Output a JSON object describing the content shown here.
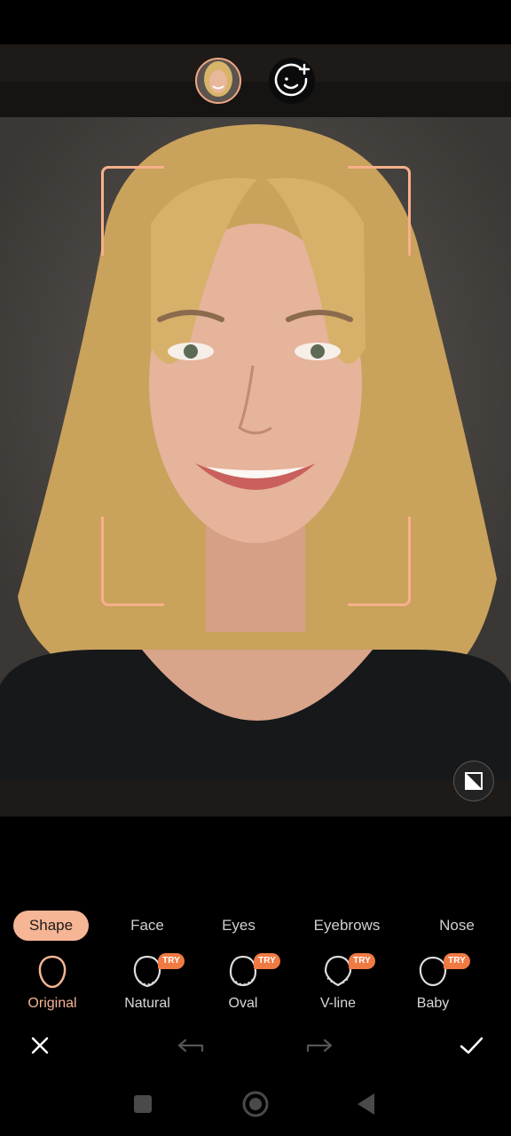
{
  "colors": {
    "accent": "#f6b595",
    "try_badge": "#f07a43",
    "background": "#000000"
  },
  "header": {
    "current_face_icon": "face-thumbnail-icon",
    "add_face_icon": "add-face-icon"
  },
  "tabs": [
    {
      "label": "Shape",
      "active": true
    },
    {
      "label": "Face",
      "active": false
    },
    {
      "label": "Eyes",
      "active": false
    },
    {
      "label": "Eyebrows",
      "active": false
    },
    {
      "label": "Nose",
      "active": false
    }
  ],
  "options": [
    {
      "label": "Original",
      "selected": true,
      "badge": ""
    },
    {
      "label": "Natural",
      "selected": false,
      "badge": "TRY"
    },
    {
      "label": "Oval",
      "selected": false,
      "badge": "TRY"
    },
    {
      "label": "V-line",
      "selected": false,
      "badge": "TRY"
    },
    {
      "label": "Baby",
      "selected": false,
      "badge": "TRY"
    }
  ],
  "actions": {
    "cancel_icon": "close-icon",
    "undo_icon": "undo-icon",
    "redo_icon": "redo-icon",
    "confirm_icon": "checkmark-icon",
    "compare_icon": "compare-icon"
  },
  "navbar": {
    "recents_icon": "square-icon",
    "home_icon": "circle-icon",
    "back_icon": "triangle-back-icon"
  }
}
